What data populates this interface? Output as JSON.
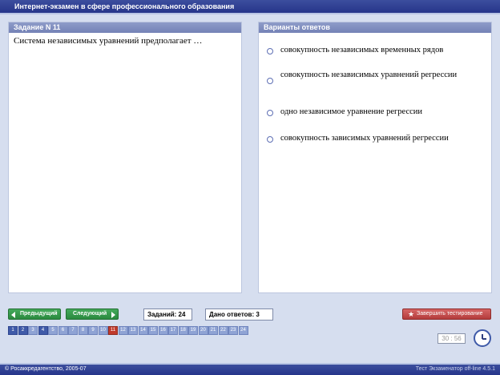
{
  "window": {
    "title": "Интернет-экзамен в сфере профессионального образования"
  },
  "task_panel": {
    "header": "Задание N 11",
    "question": "Система независимых уравнений предполагает …"
  },
  "answers_panel": {
    "header": "Варианты ответов",
    "options": [
      {
        "text": "совокупность независимых временных рядов",
        "selected": false
      },
      {
        "text": "совокупность независимых уравнений регрессии",
        "selected": false
      },
      {
        "text": "одно независимое уравнение регрессии",
        "selected": false
      },
      {
        "text": "совокупность зависимых уравнений регрессии",
        "selected": false
      }
    ]
  },
  "toolbar": {
    "prev_label": "Предыдущий",
    "next_label": "Следующий",
    "tasks_count": "Заданий: 24",
    "answered_count": "Дано ответов: 3",
    "finish_label": "Завершить тестирование"
  },
  "question_numbers": {
    "items": [
      "1",
      "2",
      "3",
      "4",
      "5",
      "6",
      "7",
      "8",
      "9",
      "10",
      "11",
      "12",
      "13",
      "14",
      "15",
      "16",
      "17",
      "18",
      "19",
      "20",
      "21",
      "22",
      "23",
      "24"
    ],
    "answered": [
      "1",
      "2",
      "4"
    ],
    "current": "11"
  },
  "timer": {
    "value": "30 : 56"
  },
  "footer": {
    "left": "© Росаккредагентство, 2005-07",
    "right": "Тест Экзаменатор off-line 4.5.1"
  },
  "colors": {
    "accent": "#26358a",
    "background": "#d6deef",
    "panel_header": "#7482b6",
    "nav_button": "#2a8a3f",
    "finish_button": "#b43c3c",
    "current_question": "#c0392b",
    "answered_question": "#3f5aa8"
  },
  "icons": {
    "prev": "arrow-left-icon",
    "next": "arrow-right-icon",
    "finish": "running-man-icon",
    "clock": "clock-icon"
  }
}
